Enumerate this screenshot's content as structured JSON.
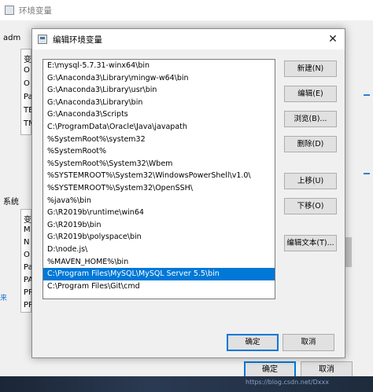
{
  "parent_window": {
    "title": "环境变量",
    "user_section_label": "adm",
    "user_rows": [
      "变",
      "O",
      "O",
      "Pa",
      "TE",
      "TM"
    ],
    "system_section_label": "系统",
    "system_rows": [
      "变",
      "M",
      "N",
      "O",
      "Pa",
      "PA",
      "PR",
      "PR"
    ],
    "ok_label": "确定",
    "cancel_label": "取消",
    "link_text": "来"
  },
  "dialog": {
    "title": "编辑环境变量",
    "close_glyph": "✕",
    "paths": [
      "E:\\mysql-5.7.31-winx64\\bin",
      "G:\\Anaconda3\\Library\\mingw-w64\\bin",
      "G:\\Anaconda3\\Library\\usr\\bin",
      "G:\\Anaconda3\\Library\\bin",
      "G:\\Anaconda3\\Scripts",
      "C:\\ProgramData\\Oracle\\Java\\javapath",
      "%SystemRoot%\\system32",
      "%SystemRoot%",
      "%SystemRoot%\\System32\\Wbem",
      "%SYSTEMROOT%\\System32\\WindowsPowerShell\\v1.0\\",
      "%SYSTEMROOT%\\System32\\OpenSSH\\",
      "%java%\\bin",
      "G:\\R2019b\\runtime\\win64",
      "G:\\R2019b\\bin",
      "G:\\R2019b\\polyspace\\bin",
      "D:\\node.js\\",
      "%MAVEN_HOME%\\bin",
      "C:\\Program Files\\MySQL\\MySQL Server 5.5\\bin",
      "C:\\Program Files\\Git\\cmd"
    ],
    "selected_index": 17,
    "buttons": {
      "new": "新建(N)",
      "edit": "编辑(E)",
      "browse": "浏览(B)...",
      "delete": "删除(D)",
      "move_up": "上移(U)",
      "move_down": "下移(O)",
      "edit_text": "编辑文本(T)..."
    },
    "ok_label": "确定",
    "cancel_label": "取消"
  },
  "watermark": "https://blog.csdn.net/Dxxx",
  "colors": {
    "selection": "#0078d7",
    "button_face": "#e1e1e1",
    "window_bg": "#f0f0f0"
  }
}
